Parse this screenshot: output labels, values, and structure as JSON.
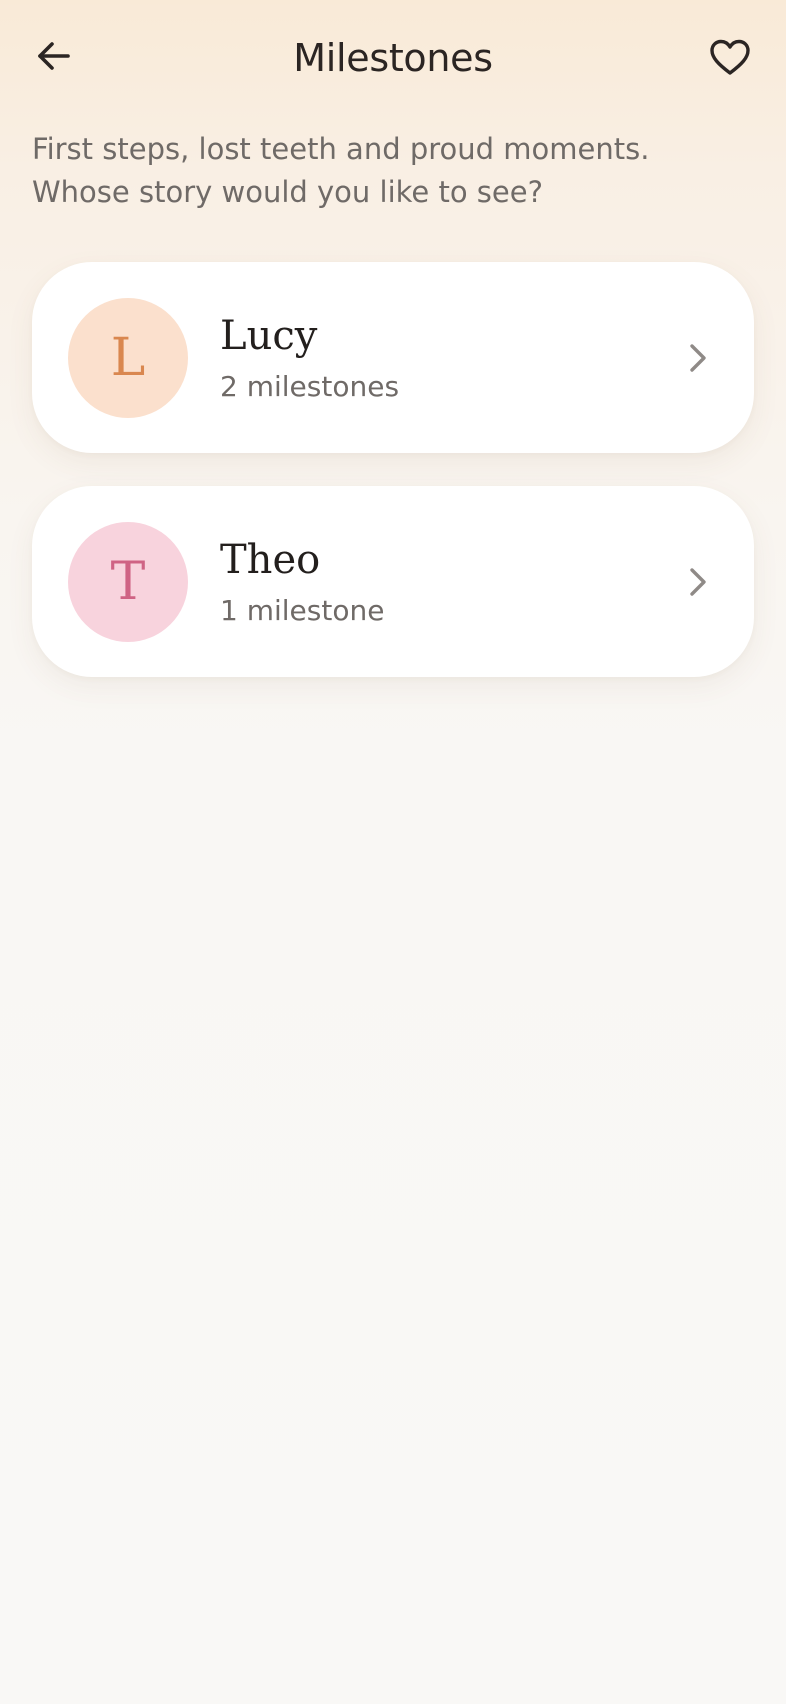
{
  "header": {
    "title": "Milestones",
    "back_icon": "arrow-left-icon",
    "favorite_icon": "heart-outline-icon"
  },
  "intro": "First steps, lost teeth and proud moments. Whose story would you like to see?",
  "children": [
    {
      "name": "Lucy",
      "initial": "L",
      "count_label": "2 milestones",
      "avatar_bg": "#fbe0cd",
      "avatar_fg": "#d9874f",
      "icon": "chevron-right-icon"
    },
    {
      "name": "Theo",
      "initial": "T",
      "count_label": "1 milestone",
      "avatar_bg": "#f8d3dd",
      "avatar_fg": "#cf6384",
      "icon": "chevron-right-icon"
    }
  ],
  "colors": {
    "text_primary": "#2b2523",
    "text_secondary": "#6f6a67",
    "chevron": "#8f8a87",
    "card_bg": "#ffffff"
  }
}
